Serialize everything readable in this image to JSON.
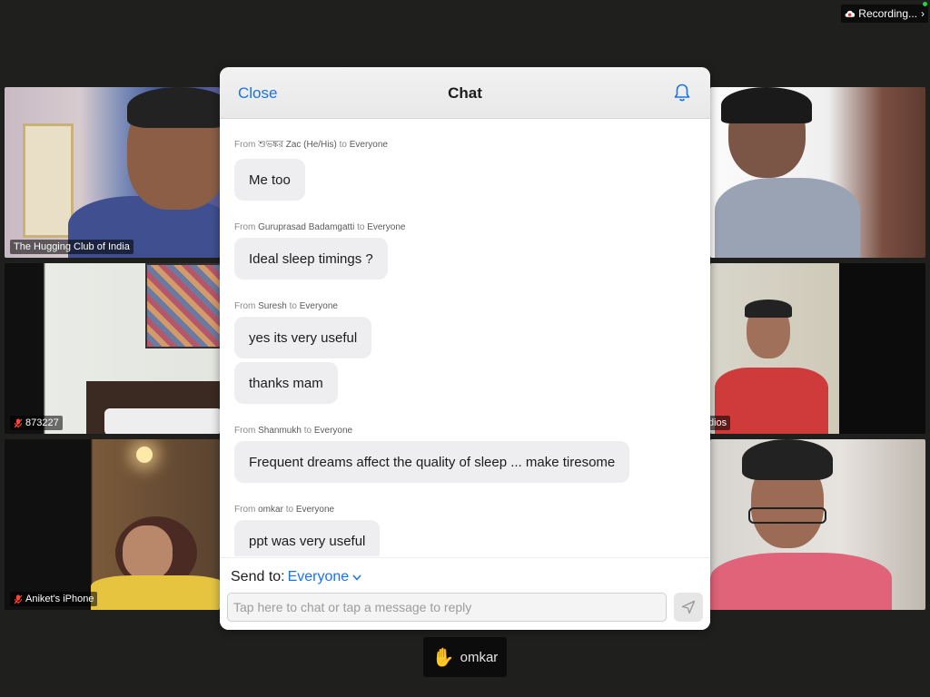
{
  "recording": {
    "label": "Recording...",
    "chevron": "›"
  },
  "tiles": [
    {
      "label": "The Hugging Club of India",
      "muted": false
    },
    {
      "label": "",
      "muted": false
    },
    {
      "label": "873227",
      "muted": true
    },
    {
      "label": "dios",
      "muted": false
    },
    {
      "label": "Aniket's iPhone",
      "muted": true
    },
    {
      "label": "",
      "muted": false
    }
  ],
  "chat": {
    "close_label": "Close",
    "title": "Chat",
    "messages": [
      {
        "from_prefix": "From",
        "sender": "শুভঙ্কর Zac (He/His)",
        "to_prefix": "to",
        "recipient": "Everyone",
        "bubbles": [
          "Me too"
        ]
      },
      {
        "from_prefix": "From",
        "sender": "Guruprasad Badamgatti",
        "to_prefix": "to",
        "recipient": "Everyone",
        "bubbles": [
          "Ideal sleep timings ?"
        ]
      },
      {
        "from_prefix": "From",
        "sender": "Suresh",
        "to_prefix": "to",
        "recipient": "Everyone",
        "bubbles": [
          "yes its very useful",
          "thanks mam"
        ]
      },
      {
        "from_prefix": "From",
        "sender": "Shanmukh",
        "to_prefix": "to",
        "recipient": "Everyone",
        "bubbles": [
          "Frequent dreams affect the quality of sleep ... make tiresome"
        ]
      },
      {
        "from_prefix": "From",
        "sender": "omkar",
        "to_prefix": "to",
        "recipient": "Everyone",
        "bubbles": [
          "ppt was very useful"
        ]
      }
    ],
    "send_to_label": "Send to:",
    "send_to_value": "Everyone",
    "input_placeholder": "Tap here to chat or tap a message to reply",
    "input_value": ""
  },
  "raised_hand": {
    "icon": "✋",
    "name": "omkar"
  },
  "colors": {
    "accent": "#1a73e8",
    "bubble": "#eeeef0",
    "background": "#1f201e"
  }
}
